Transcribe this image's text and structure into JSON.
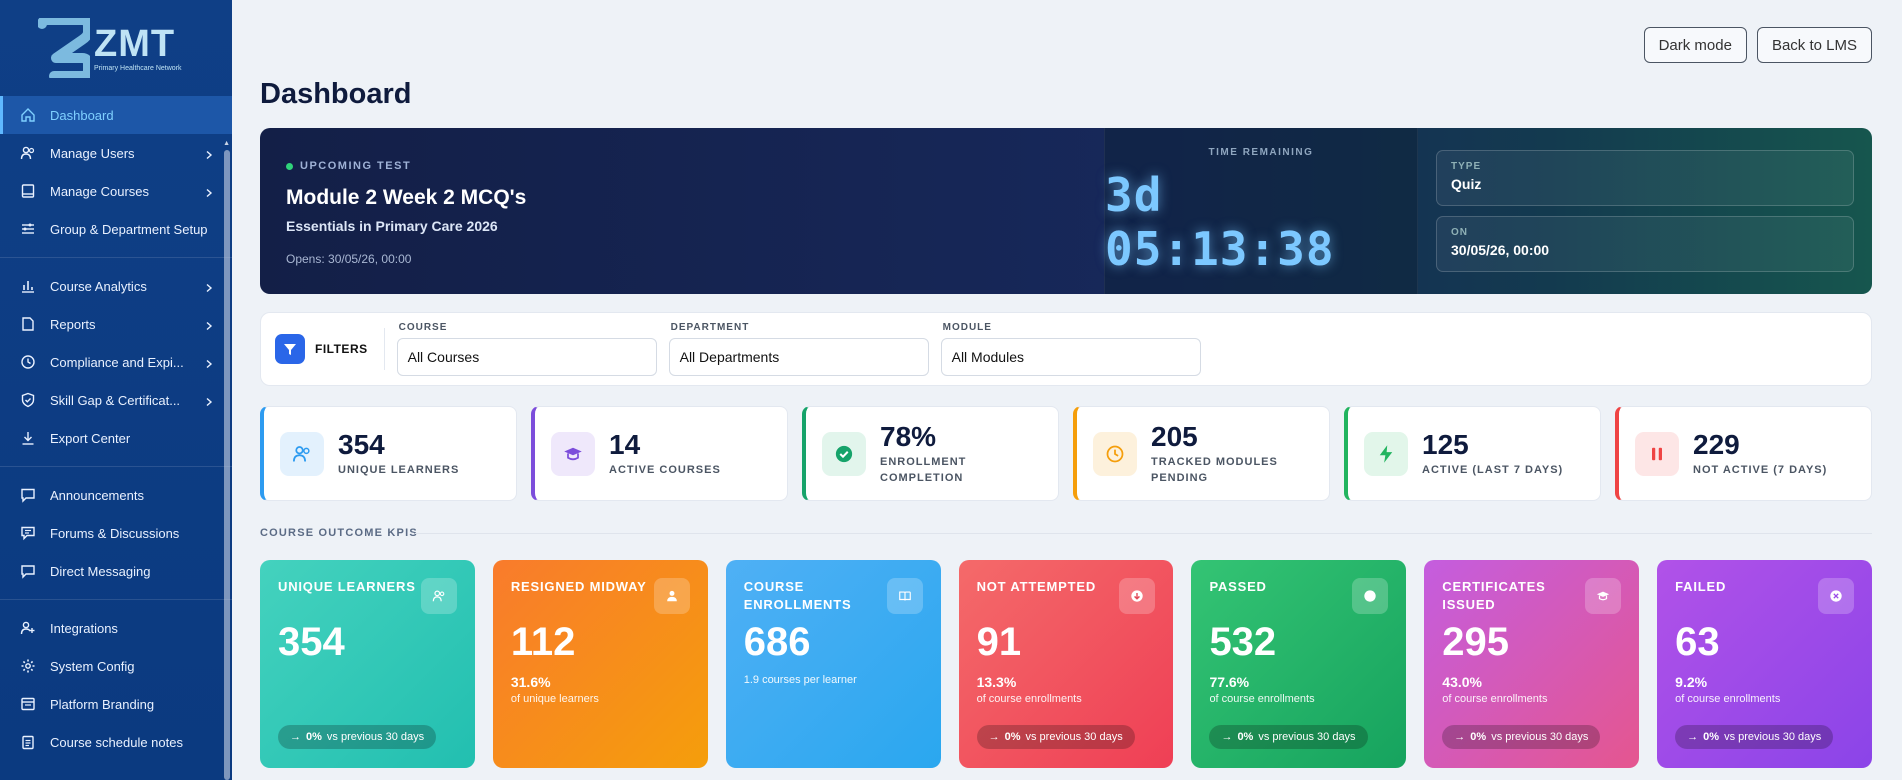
{
  "brand": {
    "title": "ZMT",
    "subtitle": "Primary Healthcare Network"
  },
  "sidebar": {
    "items": [
      {
        "label": "Dashboard",
        "icon": "home-icon",
        "chevron": false,
        "active": true
      },
      {
        "label": "Manage Users",
        "icon": "users-icon",
        "chevron": true
      },
      {
        "label": "Manage Courses",
        "icon": "book-icon",
        "chevron": true
      },
      {
        "label": "Group & Department Setup",
        "icon": "sliders-icon",
        "chevron": false
      },
      {
        "label": "Course Analytics",
        "icon": "bar-chart-icon",
        "chevron": true
      },
      {
        "label": "Reports",
        "icon": "file-icon",
        "chevron": true
      },
      {
        "label": "Compliance and Expi...",
        "icon": "clock-icon",
        "chevron": true
      },
      {
        "label": "Skill Gap & Certificat...",
        "icon": "shield-check-icon",
        "chevron": true
      },
      {
        "label": "Export Center",
        "icon": "download-icon",
        "chevron": false
      },
      {
        "label": "Announcements",
        "icon": "message-square-icon",
        "chevron": false
      },
      {
        "label": "Forums & Discussions",
        "icon": "forum-icon",
        "chevron": false
      },
      {
        "label": "Direct Messaging",
        "icon": "chat-icon",
        "chevron": false
      },
      {
        "label": "Integrations",
        "icon": "user-plus-icon",
        "chevron": false
      },
      {
        "label": "System Config",
        "icon": "gear-icon",
        "chevron": false
      },
      {
        "label": "Platform Branding",
        "icon": "layout-icon",
        "chevron": false
      },
      {
        "label": "Course schedule notes",
        "icon": "clipboard-icon",
        "chevron": false
      }
    ]
  },
  "topbar": {
    "dark_mode": "Dark mode",
    "back": "Back to LMS"
  },
  "page": {
    "title": "Dashboard"
  },
  "hero": {
    "badge": "UPCOMING TEST",
    "title": "Module 2 Week 2 MCQ's",
    "course": "Essentials in Primary Care 2026",
    "opens": "Opens: 30/05/26, 00:00",
    "time_label": "TIME REMAINING",
    "time_value": "3d 05:13:38",
    "type_label": "TYPE",
    "type_value": "Quiz",
    "on_label": "ON",
    "on_value": "30/05/26, 00:00"
  },
  "filters": {
    "label": "FILTERS",
    "course_label": "COURSE",
    "course_value": "All Courses",
    "department_label": "DEPARTMENT",
    "department_value": "All Departments",
    "module_label": "MODULE",
    "module_value": "All Modules"
  },
  "stats": [
    {
      "value": "354",
      "label": "UNIQUE LEARNERS",
      "color": "#2d9bf0",
      "bg": "#e3f1fd",
      "icon": "users-icon"
    },
    {
      "value": "14",
      "label": "ACTIVE COURSES",
      "color": "#7c4ddb",
      "bg": "#efe8fb",
      "icon": "graduation-cap-icon"
    },
    {
      "value": "78%",
      "label": "ENROLLMENT COMPLETION",
      "color": "#16a36a",
      "bg": "#e2f5ec",
      "icon": "check-circle-icon"
    },
    {
      "value": "205",
      "label": "TRACKED MODULES PENDING",
      "color": "#f59e0b",
      "bg": "#fdf1dc",
      "icon": "clock-icon"
    },
    {
      "value": "125",
      "label": "ACTIVE (LAST 7 DAYS)",
      "color": "#22b45f",
      "bg": "#e2f6ea",
      "icon": "bolt-icon"
    },
    {
      "value": "229",
      "label": "NOT ACTIVE (7 DAYS)",
      "color": "#ef4444",
      "bg": "#fde6e6",
      "icon": "pause-icon"
    }
  ],
  "section": {
    "title": "COURSE OUTCOME KPIS"
  },
  "kpis": [
    {
      "title": "UNIQUE LEARNERS",
      "value": "354",
      "percent": "",
      "sub": "",
      "meta": "",
      "trend_pct": "0%",
      "trend_text": "vs previous 30 days",
      "gradient": [
        "#44d2be",
        "#22bfb0"
      ],
      "icon": "users-icon"
    },
    {
      "title": "RESIGNED MIDWAY",
      "value": "112",
      "percent": "31.6%",
      "sub": "of unique learners",
      "meta": "",
      "trend_pct": "",
      "trend_text": "",
      "gradient": [
        "#f97b2c",
        "#f59e0b"
      ],
      "icon": "user-icon"
    },
    {
      "title": "COURSE ENROLLMENTS",
      "value": "686",
      "percent": "",
      "sub": "",
      "meta": "1.9 courses per learner",
      "trend_pct": "",
      "trend_text": "",
      "gradient": [
        "#4fb0f5",
        "#2aa7ef"
      ],
      "icon": "book-open-icon"
    },
    {
      "title": "NOT ATTEMPTED",
      "value": "91",
      "percent": "13.3%",
      "sub": "of course enrollments",
      "meta": "",
      "trend_pct": "0%",
      "trend_text": "vs previous 30 days",
      "gradient": [
        "#f46a6a",
        "#ef3f55"
      ],
      "icon": "arrow-down-circle-icon"
    },
    {
      "title": "PASSED",
      "value": "532",
      "percent": "77.6%",
      "sub": "of course enrollments",
      "meta": "",
      "trend_pct": "0%",
      "trend_text": "vs previous 30 days",
      "gradient": [
        "#34c474",
        "#16a35e"
      ],
      "icon": "check-circle-icon"
    },
    {
      "title": "CERTIFICATES ISSUED",
      "value": "295",
      "percent": "43.0%",
      "sub": "of course enrollments",
      "meta": "",
      "trend_pct": "0%",
      "trend_text": "vs previous 30 days",
      "gradient": [
        "#c45ddf",
        "#e5568f"
      ],
      "icon": "graduation-cap-icon"
    },
    {
      "title": "FAILED",
      "value": "63",
      "percent": "9.2%",
      "sub": "of course enrollments",
      "meta": "",
      "trend_pct": "0%",
      "trend_text": "vs previous 30 days",
      "gradient": [
        "#b152e8",
        "#8b44e8"
      ],
      "icon": "x-circle-icon"
    }
  ]
}
